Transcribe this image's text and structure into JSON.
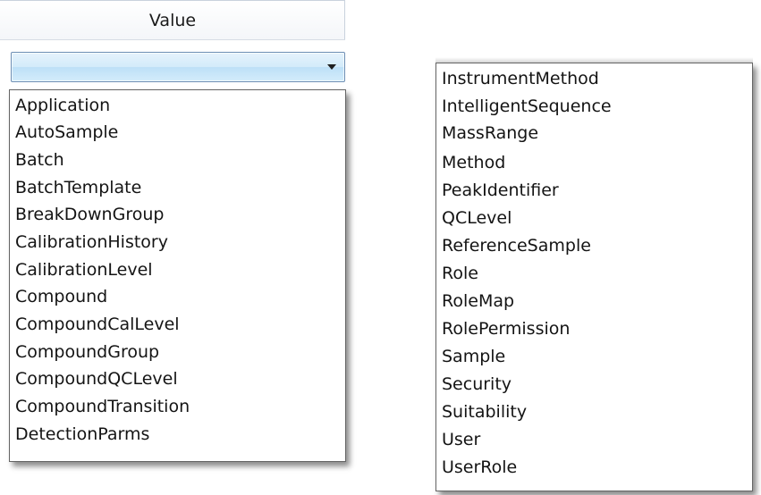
{
  "header": {
    "label": "Value"
  },
  "combo": {
    "value": "",
    "arrow_icon": "chevron-down-icon"
  },
  "left_list": {
    "items": [
      "Application",
      "AutoSample",
      "Batch",
      "BatchTemplate",
      "BreakDownGroup",
      "CalibrationHistory",
      "CalibrationLevel",
      "Compound",
      "CompoundCalLevel",
      "CompoundGroup",
      "CompoundQCLevel",
      "CompoundTransition",
      "DetectionParms"
    ]
  },
  "right_list": {
    "items": [
      "InstrumentMethod",
      "IntelligentSequence",
      "MassRange",
      "Method",
      "PeakIdentifier",
      "QCLevel",
      "ReferenceSample",
      "Role",
      "RoleMap",
      "RolePermission",
      "Sample",
      "Security",
      "Suitability",
      "User",
      "UserRole"
    ]
  },
  "colors": {
    "combo_gradient_top": "#e6f3fc",
    "combo_gradient_bottom": "#bde0f7",
    "combo_border": "#6d8fb5",
    "list_border": "#646464"
  }
}
